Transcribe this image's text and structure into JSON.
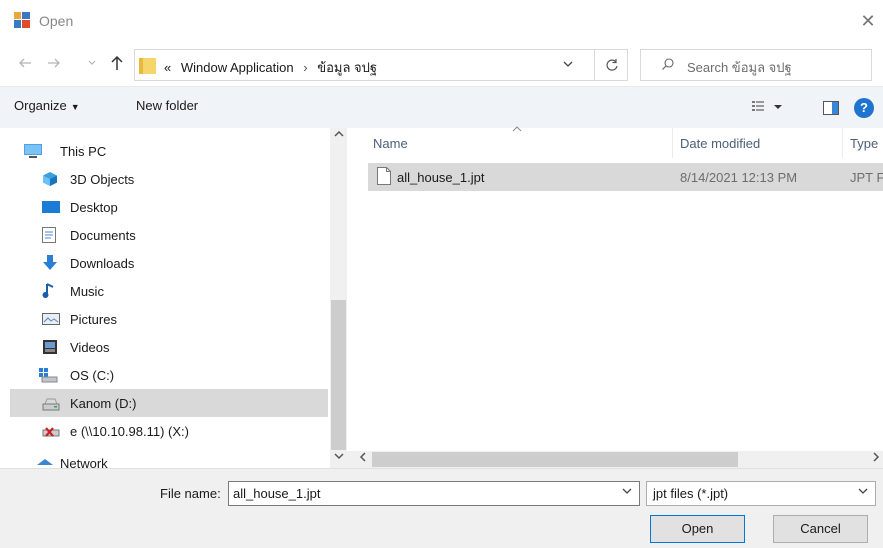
{
  "window": {
    "title": "Open",
    "icon": "app-form-icon",
    "close_label": "✕"
  },
  "address": {
    "back_icon": "back-arrow-icon",
    "forward_icon": "forward-arrow-icon",
    "up_icon": "up-arrow-icon",
    "breadcrumb_prefix": "«",
    "path": [
      "Window Application",
      "ข้อมูล จปฐ"
    ],
    "separator": "›",
    "refresh_icon": "refresh-icon",
    "search_placeholder": "Search ข้อมูล จปฐ"
  },
  "toolbar": {
    "organize_label": "Organize",
    "new_folder_label": "New folder",
    "view_icon": "view-options-icon",
    "preview_icon": "preview-pane-icon",
    "help_label": "?"
  },
  "nav": {
    "items": [
      {
        "label": "This PC",
        "icon": "computer-icon"
      },
      {
        "label": "3D Objects",
        "icon": "cube-icon"
      },
      {
        "label": "Desktop",
        "icon": "desktop-icon"
      },
      {
        "label": "Documents",
        "icon": "documents-icon"
      },
      {
        "label": "Downloads",
        "icon": "download-icon"
      },
      {
        "label": "Music",
        "icon": "music-icon"
      },
      {
        "label": "Pictures",
        "icon": "pictures-icon"
      },
      {
        "label": "Videos",
        "icon": "videos-icon"
      },
      {
        "label": "OS (C:)",
        "icon": "windows-drive-icon"
      },
      {
        "label": "Kanom (D:)",
        "icon": "drive-icon",
        "selected": true
      },
      {
        "label": "e (\\\\10.10.98.11) (X:)",
        "icon": "network-drive-disconnected-icon"
      },
      {
        "label": "Network",
        "icon": "network-icon"
      }
    ]
  },
  "file_list": {
    "columns": {
      "name": "Name",
      "date": "Date modified",
      "type": "Type"
    },
    "rows": [
      {
        "name": "all_house_1.jpt",
        "date": "8/14/2021 12:13 PM",
        "type": "JPT File"
      }
    ]
  },
  "bottom": {
    "filename_label": "File name:",
    "filename_value": "all_house_1.jpt",
    "filetype_value": "jpt files (*.jpt)",
    "open_label": "Open",
    "cancel_label": "Cancel"
  },
  "colors": {
    "accent": "#0078d7",
    "toolbar_bg": "#f0f4f9",
    "selection_bg": "#d9d9d9",
    "help_blue": "#1e74cf"
  }
}
